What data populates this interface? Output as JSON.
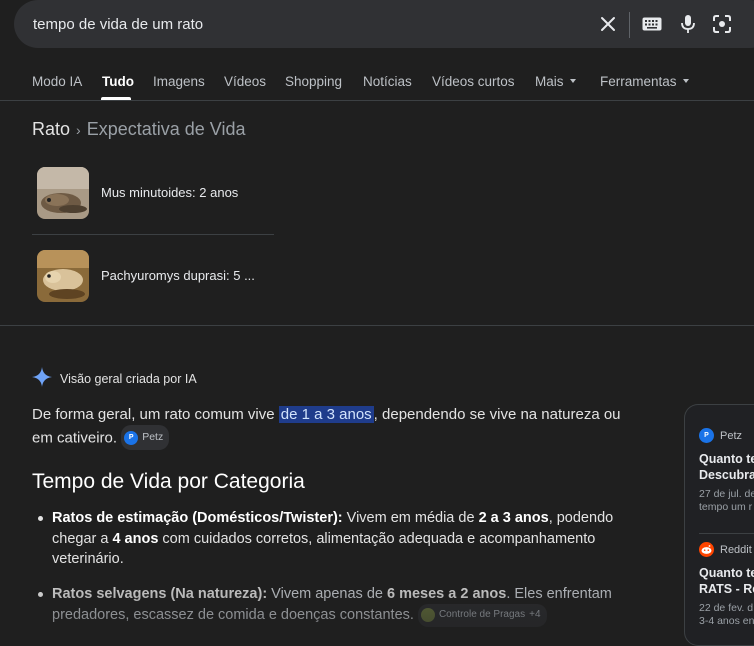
{
  "search": {
    "query": "tempo de vida de um rato"
  },
  "tabs": [
    {
      "label": "Modo IA"
    },
    {
      "label": "Tudo"
    },
    {
      "label": "Imagens"
    },
    {
      "label": "Vídeos"
    },
    {
      "label": "Shopping"
    },
    {
      "label": "Notícias"
    },
    {
      "label": "Vídeos curtos"
    },
    {
      "label": "Mais"
    },
    {
      "label": "Ferramentas"
    }
  ],
  "breadcrumb": {
    "entity": "Rato",
    "separator": "›",
    "topic": "Expectativa de Vida"
  },
  "entities": [
    {
      "label": "Mus minutoides: 2 anos"
    },
    {
      "label": "Pachyuromys duprasi: 5 ..."
    }
  ],
  "ai_overview": {
    "heading": "Visão geral criada por IA",
    "intro_before": "De forma geral, um rato comum vive ",
    "intro_highlight": "de 1 a 3 anos",
    "intro_after": ", dependendo se vive na natureza ou em cativeiro.",
    "intro_source": "Petz",
    "section_title": "Tempo de Vida por Categoria",
    "bullets": [
      {
        "label": "Ratos de estimação (Domésticos/Twister):",
        "t1": " Vivem em média de ",
        "b1": "2 a 3 anos",
        "t2": ", podendo chegar a ",
        "b2": "4 anos",
        "t3": " com cuidados corretos, alimentação adequada e acompanhamento veterinário."
      },
      {
        "label": "Ratos selvagens (Na natureza):",
        "t1": " Vivem apenas de ",
        "b1": "6 meses a 2 anos",
        "t2": ". Eles enfrentam predadores, escassez de comida e doenças constantes.",
        "source": "Controle de Pragas",
        "source_more": "+4"
      }
    ]
  },
  "sources": [
    {
      "site": "Petz",
      "title_l1": "Quanto te",
      "title_l2": "Descubra",
      "meta_l1": "27 de jul. de",
      "meta_l2": "tempo um r"
    },
    {
      "site": "Reddit",
      "title_l1": "Quanto te",
      "title_l2": "RATS - Re",
      "meta_l1": "22 de fev. d",
      "meta_l2": "3-4 anos en"
    }
  ]
}
